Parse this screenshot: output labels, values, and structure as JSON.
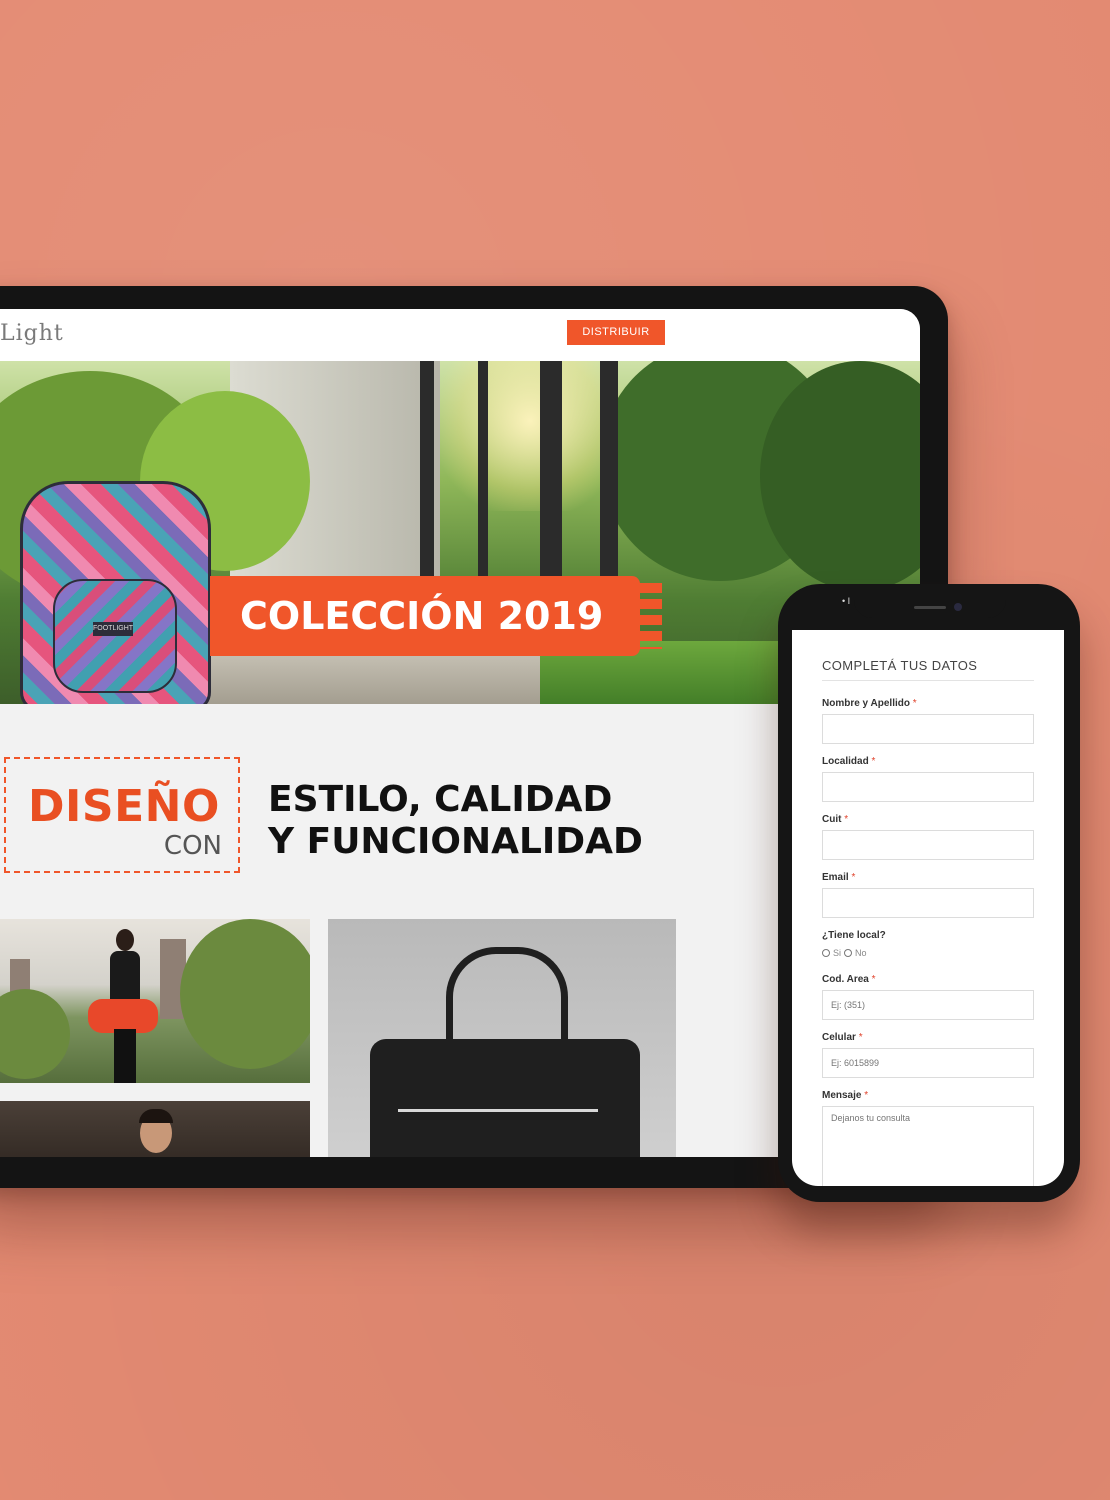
{
  "tablet": {
    "header": {
      "logo_text": "Light",
      "cta_label": "DISTRIBUIR"
    },
    "hero": {
      "banner_text": "COLECCIÓN 2019",
      "backpack_tag": "FOOTLIGHT"
    },
    "design_section": {
      "big_word": "DISEÑO",
      "small_word": "CON",
      "tagline_line1": "ESTILO, CALIDAD",
      "tagline_line2": "Y FUNCIONALIDAD"
    }
  },
  "phone": {
    "status": "• I",
    "form": {
      "title": "COMPLETÁ TUS DATOS",
      "fields": [
        {
          "label": "Nombre y Apellido",
          "placeholder": ""
        },
        {
          "label": "Localidad",
          "placeholder": ""
        },
        {
          "label": "Cuit",
          "placeholder": ""
        },
        {
          "label": "Email",
          "placeholder": ""
        }
      ],
      "tiene_local": {
        "label": "¿Tiene local?",
        "options": [
          "Si",
          "No"
        ]
      },
      "cod_area": {
        "label": "Cod. Area",
        "placeholder": "Ej: (351)"
      },
      "celular": {
        "label": "Celular",
        "placeholder": "Ej: 6015899"
      },
      "mensaje": {
        "label": "Mensaje",
        "placeholder": "Dejanos tu consulta"
      },
      "required_mark": "*"
    }
  },
  "colors": {
    "background": "#e38a72",
    "accent": "#f0562a",
    "required": "#e0412a"
  }
}
